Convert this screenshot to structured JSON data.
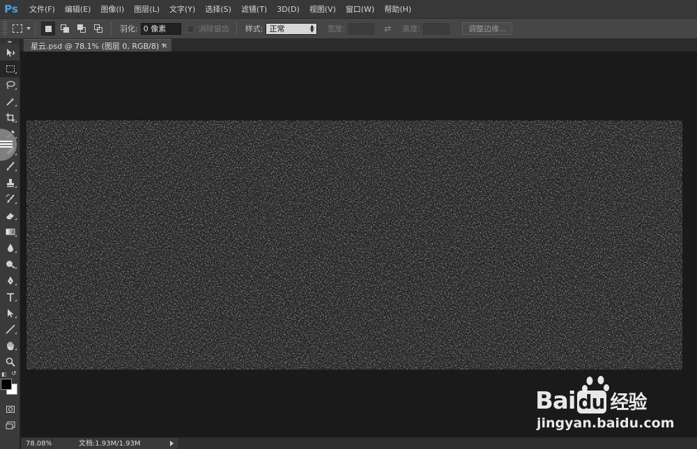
{
  "app": {
    "logo": "Ps"
  },
  "menu": [
    {
      "label": "文件(F)"
    },
    {
      "label": "编辑(E)"
    },
    {
      "label": "图像(I)"
    },
    {
      "label": "图层(L)"
    },
    {
      "label": "文字(Y)"
    },
    {
      "label": "选择(S)"
    },
    {
      "label": "滤镜(T)"
    },
    {
      "label": "3D(D)"
    },
    {
      "label": "视图(V)"
    },
    {
      "label": "窗口(W)"
    },
    {
      "label": "帮助(H)"
    }
  ],
  "options": {
    "feather_label": "羽化:",
    "feather_value": "0 像素",
    "antialias_label": "消除锯齿",
    "style_label": "样式:",
    "style_value": "正常",
    "width_label": "宽度:",
    "height_label": "高度:",
    "refine_edge_label": "调整边缘..."
  },
  "document": {
    "tab_title": "星云.psd @ 78.1% (图层 0, RGB/8) *",
    "close_glyph": "×"
  },
  "status": {
    "zoom": "78.08%",
    "doc_info": "文档:1.93M/1.93M"
  },
  "watermark": {
    "brand_left": "Bai",
    "brand_du": "du",
    "brand_cn": "经验",
    "url": "jingyan.baidu.com"
  },
  "tools": [
    {
      "icon": "move-icon"
    },
    {
      "icon": "rect-marquee-icon"
    },
    {
      "icon": "lasso-icon"
    },
    {
      "icon": "magic-wand-icon"
    },
    {
      "icon": "crop-icon"
    },
    {
      "icon": "eyedropper-icon"
    },
    {
      "icon": "healing-brush-icon"
    },
    {
      "icon": "brush-icon"
    },
    {
      "icon": "clone-stamp-icon"
    },
    {
      "icon": "history-brush-icon"
    },
    {
      "icon": "eraser-icon"
    },
    {
      "icon": "gradient-icon"
    },
    {
      "icon": "blur-icon"
    },
    {
      "icon": "dodge-icon"
    },
    {
      "icon": "pen-icon"
    },
    {
      "icon": "type-icon"
    },
    {
      "icon": "path-selection-icon"
    },
    {
      "icon": "line-icon"
    },
    {
      "icon": "hand-icon"
    },
    {
      "icon": "zoom-icon"
    }
  ],
  "colors": {
    "foreground": "#000000",
    "background": "#ffffff",
    "accent": "#4aa0e8"
  }
}
